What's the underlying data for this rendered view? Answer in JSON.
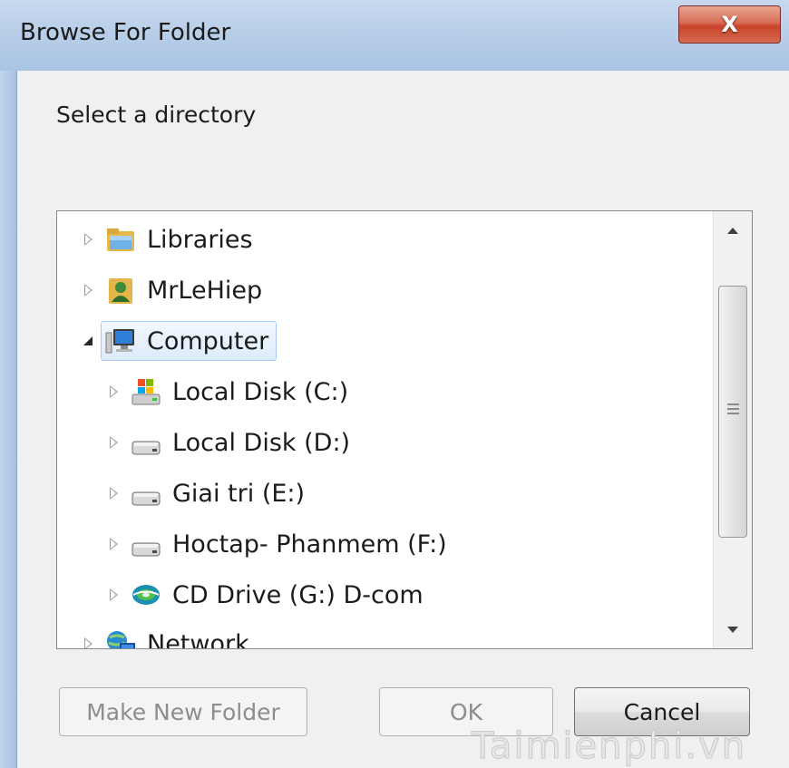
{
  "window": {
    "title": "Browse For Folder",
    "close_label": "X"
  },
  "dialog": {
    "prompt": "Select a directory"
  },
  "tree": {
    "items": [
      {
        "label": "Libraries",
        "icon": "libraries-icon",
        "expanded": false,
        "selected": false,
        "level": 0
      },
      {
        "label": "MrLeHiep",
        "icon": "user-folder-icon",
        "expanded": false,
        "selected": false,
        "level": 0
      },
      {
        "label": "Computer",
        "icon": "computer-icon",
        "expanded": true,
        "selected": true,
        "level": 0
      },
      {
        "label": "Local Disk (C:)",
        "icon": "system-drive-icon",
        "expanded": false,
        "selected": false,
        "level": 1
      },
      {
        "label": "Local Disk (D:)",
        "icon": "hard-drive-icon",
        "expanded": false,
        "selected": false,
        "level": 1
      },
      {
        "label": "Giai tri (E:)",
        "icon": "hard-drive-icon",
        "expanded": false,
        "selected": false,
        "level": 1
      },
      {
        "label": "Hoctap- Phanmem (F:)",
        "icon": "hard-drive-icon",
        "expanded": false,
        "selected": false,
        "level": 1
      },
      {
        "label": "CD Drive (G:) D-com",
        "icon": "cd-drive-icon",
        "expanded": false,
        "selected": false,
        "level": 1
      },
      {
        "label": "Network",
        "icon": "network-icon",
        "expanded": false,
        "selected": false,
        "level": 0
      }
    ]
  },
  "buttons": {
    "make_new_folder": "Make New Folder",
    "ok": "OK",
    "cancel": "Cancel"
  },
  "watermark": "Taimienphi.vn",
  "colors": {
    "selection_fill": "#dcebfc",
    "selection_border": "#a6c8ee",
    "close_button": "#c9442b",
    "title_bar": "#b9cfe9"
  }
}
